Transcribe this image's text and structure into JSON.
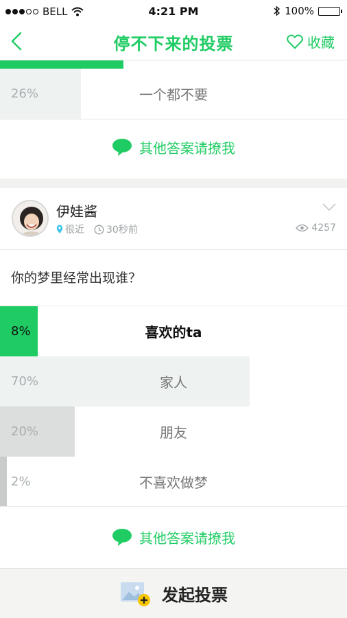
{
  "status_bar": {
    "carrier": "BELL",
    "time": "4:21 PM",
    "battery": "100%"
  },
  "nav": {
    "title": "停不下来的投票",
    "favorite_label": "收藏"
  },
  "colors": {
    "accent": "#1fcc63",
    "fill_light": "#eef2f1",
    "fill_gray": "#dcdedd",
    "fill_dark": "#c8cbca"
  },
  "previous_poll": {
    "last_option": {
      "percent": "26%",
      "label": "一个都不要",
      "fraction": 0.26
    },
    "other_answer_label": "其他答案请撩我"
  },
  "poll": {
    "author": "伊娃酱",
    "location": "很近",
    "time_ago": "30秒前",
    "views": "4257",
    "question": "你的梦里经常出现谁？",
    "options": [
      {
        "percent": "8%",
        "label": "喜欢的ta",
        "fraction": 0.08
      },
      {
        "percent": "70%",
        "label": "家人",
        "fraction": 0.7
      },
      {
        "percent": "20%",
        "label": "朋友",
        "fraction": 0.2
      },
      {
        "percent": "2%",
        "label": "不喜欢做梦",
        "fraction": 0.02
      }
    ],
    "other_answer_label": "其他答案请撩我"
  },
  "bottom": {
    "launch_label": "发起投票"
  }
}
